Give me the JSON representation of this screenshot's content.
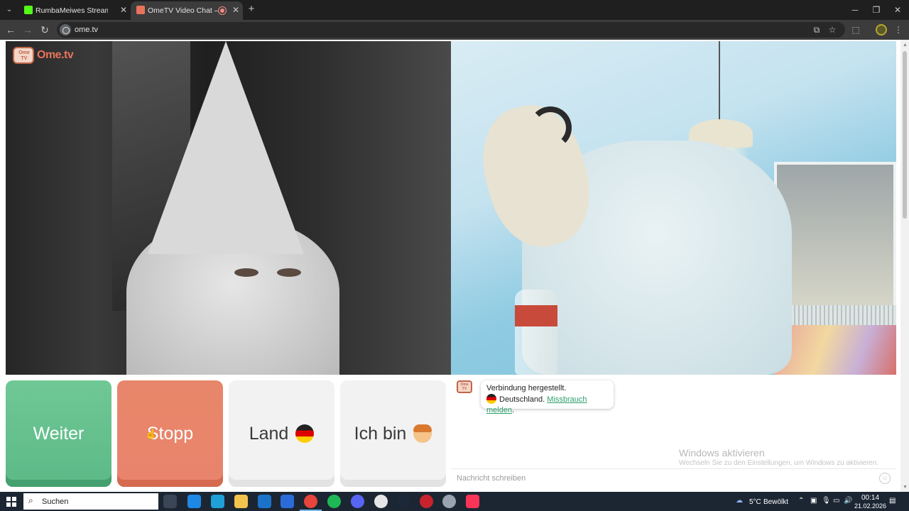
{
  "browser": {
    "tabs": [
      {
        "title": "RumbaMeiwes Stream - Watch",
        "active": false,
        "favicon_color": "#53fc18"
      },
      {
        "title": "OmeTV Video Chat — Ome",
        "active": true,
        "favicon_color": "#e9735a"
      }
    ],
    "url": "ome.tv",
    "window_controls": {
      "minimize": "─",
      "restore": "❐",
      "close": "✕"
    }
  },
  "logo": {
    "tv_label": "Ome TV",
    "text": "Ome.tv"
  },
  "controls": {
    "next_label": "Weiter",
    "stop_label": "Stopp",
    "country_label": "Land",
    "iam_label": "Ich bin"
  },
  "chat": {
    "logo_label": "Ome TV",
    "status": "Verbindung hergestellt.",
    "country": "Deutschland.",
    "report_link": "Missbrauch melden",
    "report_suffix": ".",
    "placeholder": "Nachricht schreiben",
    "watermark_title": "Windows aktivieren",
    "watermark_sub": "Wechseln Sie zu den Einstellungen, um Windows zu aktivieren."
  },
  "taskbar": {
    "search_label": "Suchen",
    "apps": [
      {
        "name": "task-view",
        "color": "#3a4555"
      },
      {
        "name": "media-player",
        "color": "#1e88e5"
      },
      {
        "name": "edge",
        "color": "#1fa0d6"
      },
      {
        "name": "file-explorer",
        "color": "#f3c34b"
      },
      {
        "name": "outlook",
        "color": "#1a73c9"
      },
      {
        "name": "store",
        "color": "#2b6bd8"
      },
      {
        "name": "chrome",
        "color": "#e8453c"
      },
      {
        "name": "spotify",
        "color": "#1db954"
      },
      {
        "name": "discord",
        "color": "#5865f2"
      },
      {
        "name": "wordpress",
        "color": "#e6e6e6"
      },
      {
        "name": "steam",
        "color": "#1b2838"
      },
      {
        "name": "app-red",
        "color": "#c8232c"
      },
      {
        "name": "app-gray",
        "color": "#9aa4ae"
      },
      {
        "name": "itunes",
        "color": "#fa3358"
      }
    ],
    "weather_temp": "5°C",
    "weather_text": "Bewölkt",
    "time": "00:14",
    "date": "21.02.2026"
  }
}
